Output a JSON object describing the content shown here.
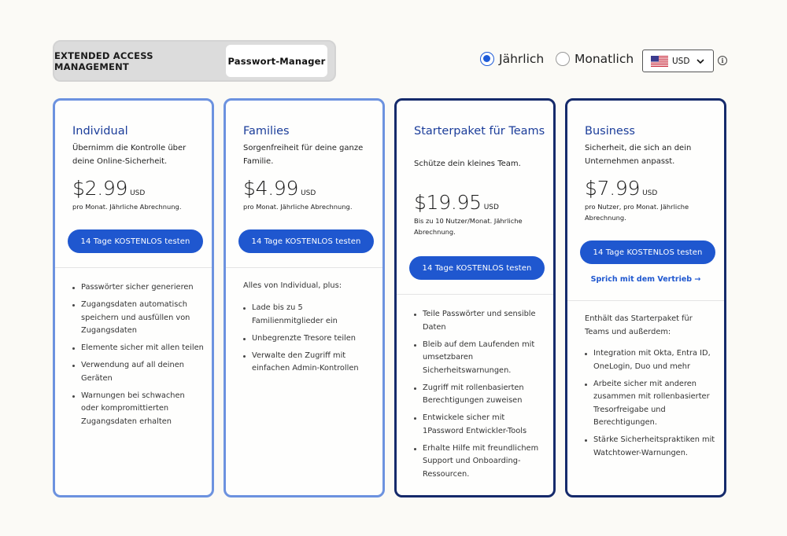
{
  "segment": {
    "tabs": [
      {
        "label": "EXTENDED ACCESS MANAGEMENT",
        "active": false
      },
      {
        "label": "Passwort-Manager",
        "active": true
      }
    ]
  },
  "billing": {
    "yearly_label": "Jährlich",
    "monthly_label": "Monatlich",
    "selected": "yearly"
  },
  "currency": {
    "code": "USD",
    "flag_icon": "us-flag-icon"
  },
  "colors": {
    "accent": "#1f57cf",
    "plan_title": "#1b3d9a",
    "light_border": "#6c92df",
    "dark_border": "#152a6b"
  },
  "plans": [
    {
      "name": "Individual",
      "description": "Übernimm die Kontrolle über deine Online-Sicherheit.",
      "price": "$2.99",
      "currency": "USD",
      "price_note": "pro Monat. Jährliche Abrechnung.",
      "cta": "14 Tage KOSTENLOS testen",
      "features": [
        "Passwörter sicher generieren",
        "Zugangsdaten automatisch speichern und ausfüllen von Zugangsdaten",
        "Elemente sicher mit allen teilen",
        "Verwendung auf all deinen Geräten",
        "Warnungen bei schwachen oder kompromittierten Zugangsdaten erhalten"
      ]
    },
    {
      "name": "Families",
      "description": "Sorgenfreiheit für deine ganze Familie.",
      "price": "$4.99",
      "currency": "USD",
      "price_note": "pro Monat. Jährliche Abrechnung.",
      "cta": "14 Tage KOSTENLOS testen",
      "intro": "Alles von Individual, plus:",
      "features": [
        "Lade bis zu 5 Familienmitglieder ein",
        "Unbegrenzte Tresore teilen",
        "Verwalte den Zugriff mit einfachen Admin-Kontrollen"
      ]
    },
    {
      "name": "Starterpaket für Teams",
      "description": "Schütze dein kleines Team.",
      "price": "$19.95",
      "currency": "USD",
      "price_note": "Bis zu 10 Nutzer/Monat. Jährliche Abrechnung.",
      "cta": "14 Tage KOSTENLOS testen",
      "features": [
        "Teile Passwörter und sensible Daten",
        "Bleib auf dem Laufenden mit umsetzbaren Sicherheitswarnungen.",
        "Zugriff mit rollenbasierten Berechtigungen zuweisen",
        "Entwickele sicher mit 1Password Entwickler-Tools",
        "Erhalte Hilfe mit freundlichem Support und Onboarding-Ressourcen."
      ]
    },
    {
      "name": "Business",
      "description": "Sicherheit, die sich an dein Unternehmen anpasst.",
      "price": "$7.99",
      "currency": "USD",
      "price_note": "pro Nutzer, pro Monat. Jährliche Abrechnung.",
      "cta": "14 Tage KOSTENLOS testen",
      "secondary_link": "Sprich mit dem Vertrieb →",
      "intro": "Enthält das Starterpaket für Teams und außerdem:",
      "features": [
        "Integration mit Okta, Entra ID, OneLogin, Duo und mehr",
        "Arbeite sicher mit anderen zusammen mit rollenbasierter Tresorfreigabe und Berechtigungen.",
        "Stärke Sicherheitspraktiken mit Watchtower-Warnungen."
      ]
    }
  ]
}
